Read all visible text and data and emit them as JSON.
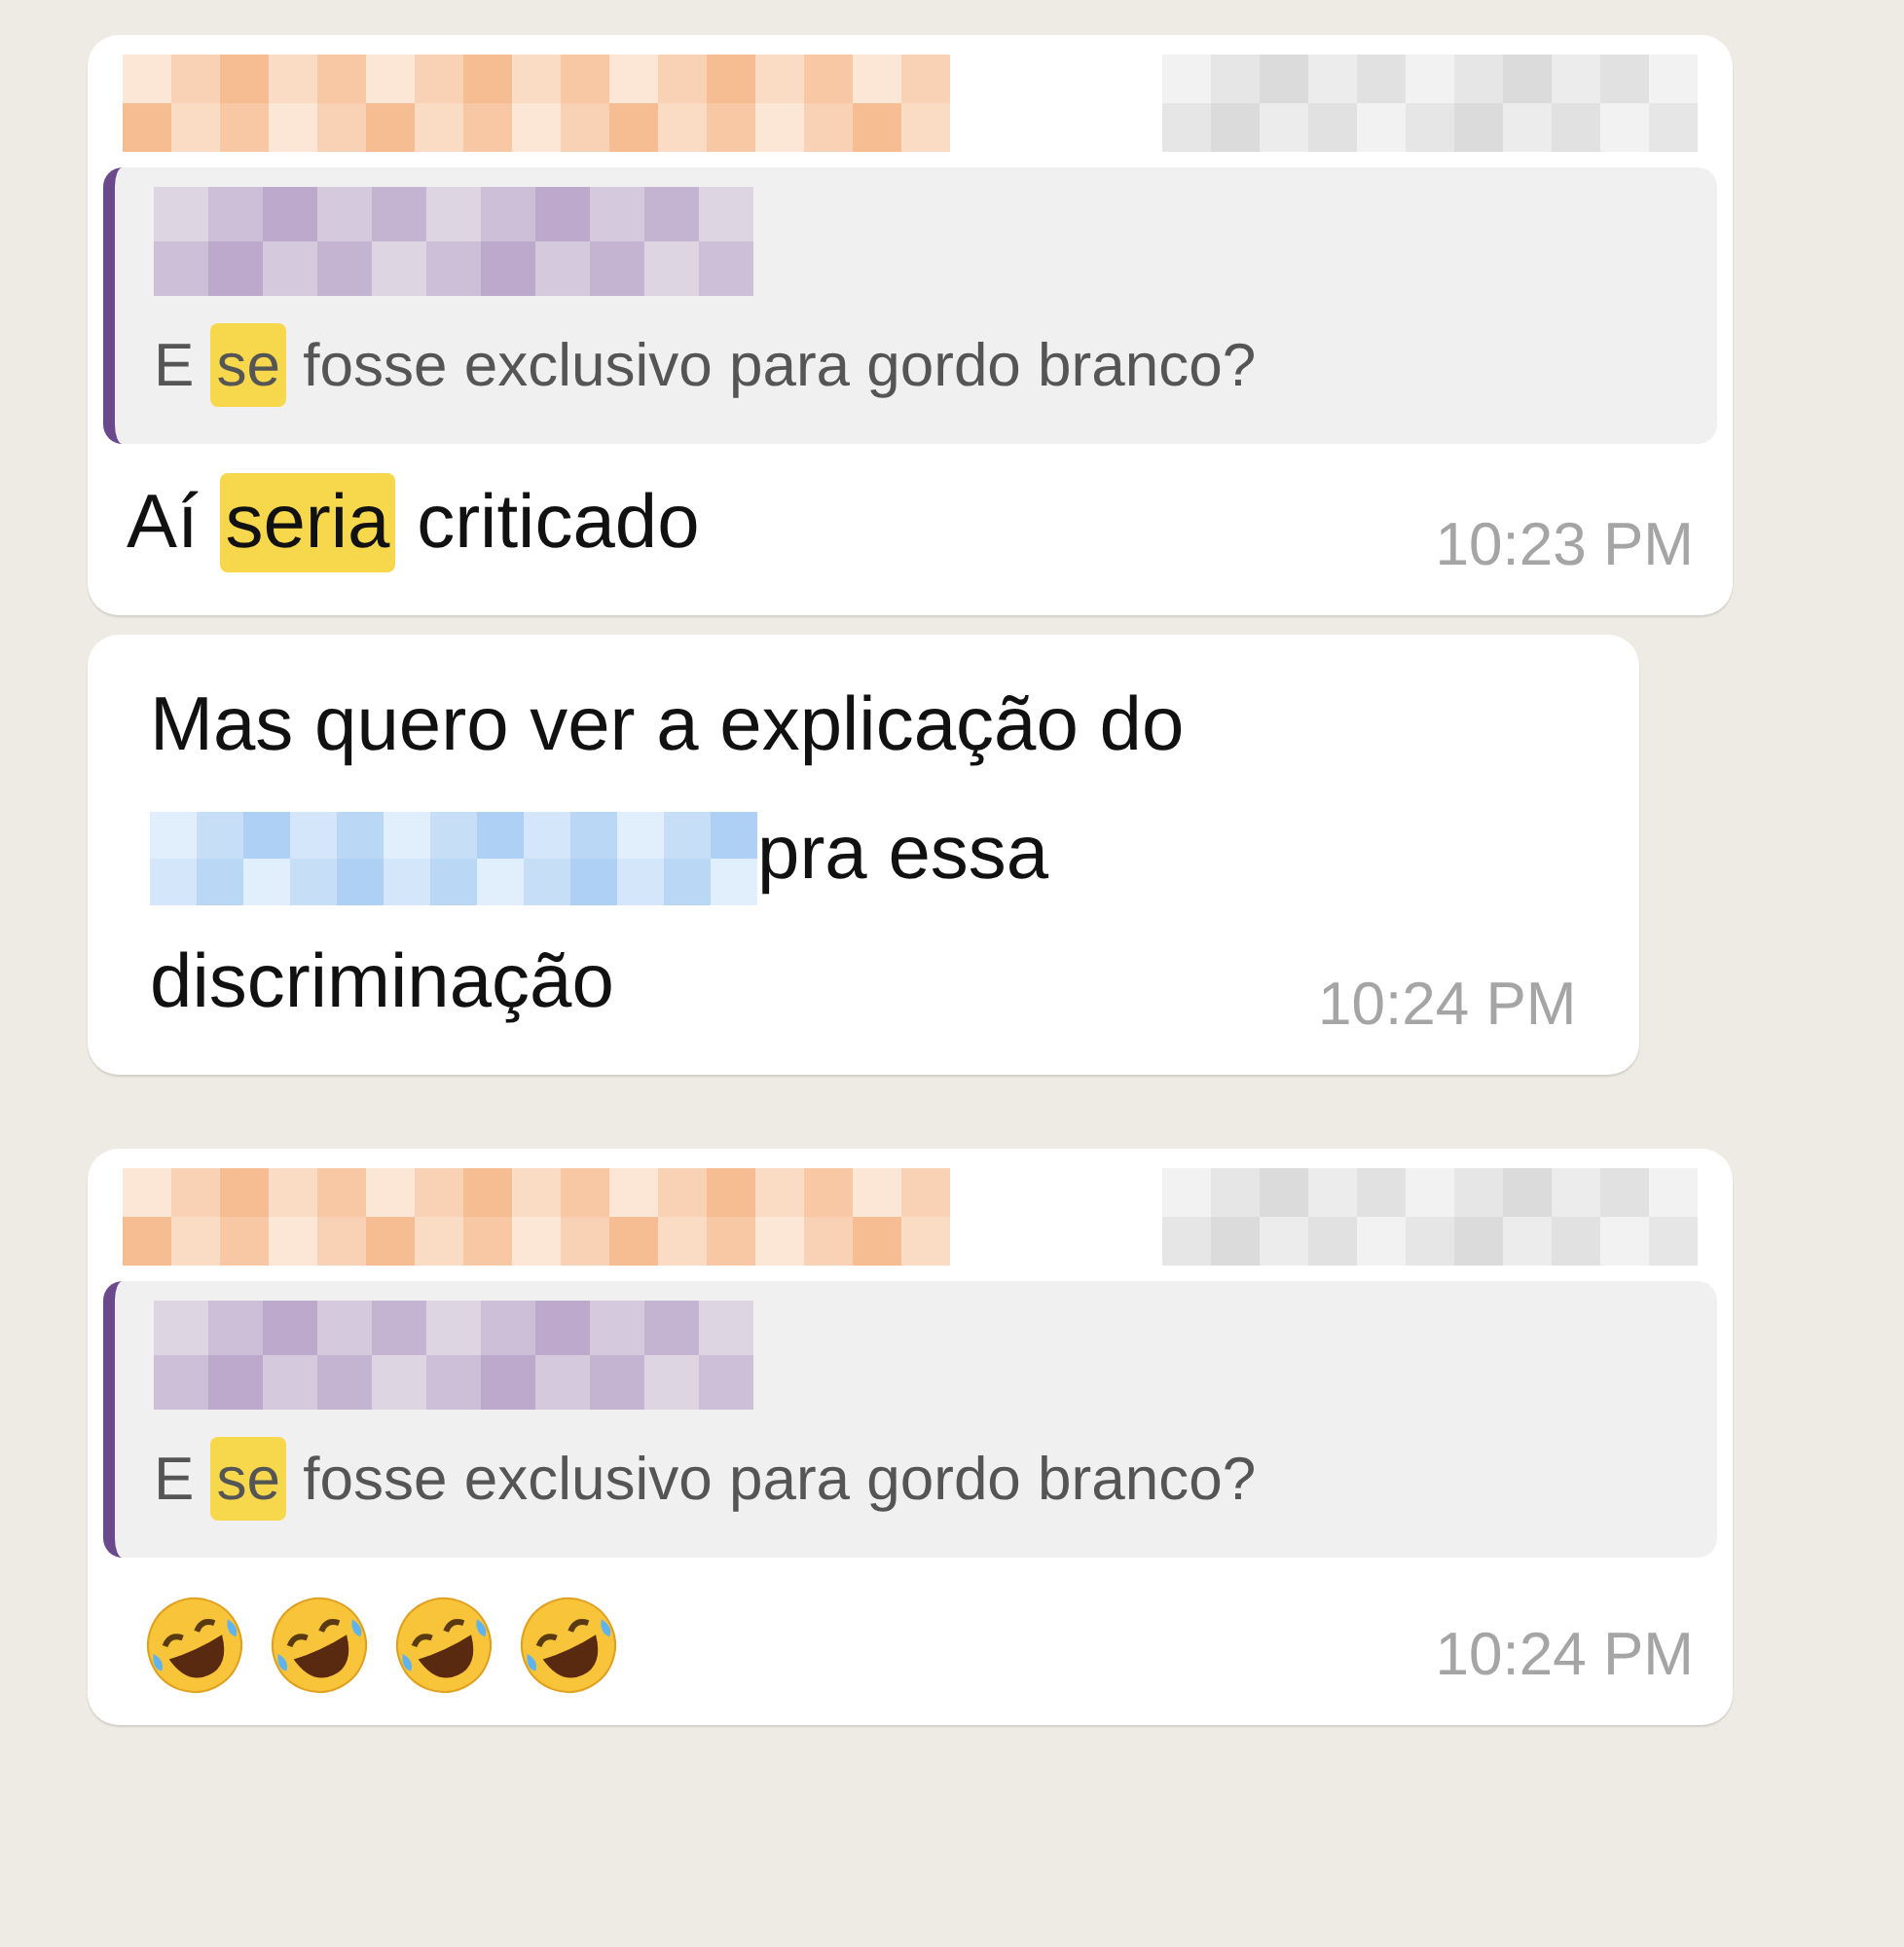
{
  "messages": [
    {
      "kind": "reply",
      "quote": {
        "text": [
          {
            "text": "E ",
            "highlighted": false
          },
          {
            "text": "se",
            "highlighted": true
          },
          {
            "text": " fosse exclusivo para gordo branco?",
            "highlighted": false
          }
        ]
      },
      "body": [
        {
          "kind": "text",
          "text": "Aí ",
          "highlighted": false
        },
        {
          "kind": "text",
          "text": "seria",
          "highlighted": true
        },
        {
          "kind": "text",
          "text": " criticado",
          "highlighted": false
        }
      ],
      "time": "10:23 PM"
    },
    {
      "kind": "plain",
      "body": [
        {
          "kind": "text",
          "text": "Mas quero ver a explicação do ",
          "highlighted": false
        },
        {
          "kind": "redacted"
        },
        {
          "kind": "text",
          "text": "pra essa discriminação",
          "highlighted": false
        }
      ],
      "time": "10:24 PM"
    },
    {
      "kind": "reply",
      "quote": {
        "text": [
          {
            "text": "E ",
            "highlighted": false
          },
          {
            "text": "se",
            "highlighted": true
          },
          {
            "text": " fosse exclusivo para gordo branco?",
            "highlighted": false
          }
        ]
      },
      "emojis": [
        {
          "kind": "rofl"
        },
        {
          "kind": "rofl"
        },
        {
          "kind": "rofl"
        },
        {
          "kind": "rofl"
        }
      ],
      "time": "10:24 PM"
    }
  ]
}
